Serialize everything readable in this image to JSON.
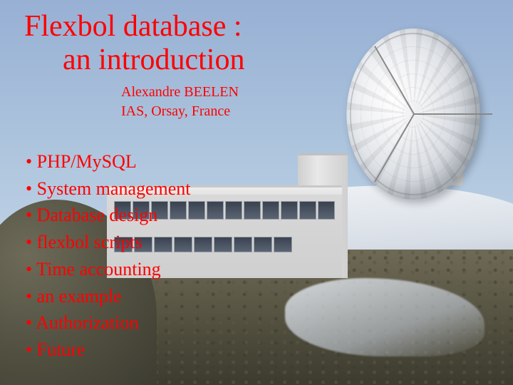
{
  "title_line1": "Flexbol database :",
  "title_line2": "an introduction",
  "author_name": "Alexandre BEELEN",
  "author_affiliation": "IAS, Orsay, France",
  "bullets": [
    "PHP/MySQL",
    "System management",
    "Database design",
    "flexbol scripts",
    "Time accounting",
    "an example",
    "Authorization",
    "Future"
  ]
}
